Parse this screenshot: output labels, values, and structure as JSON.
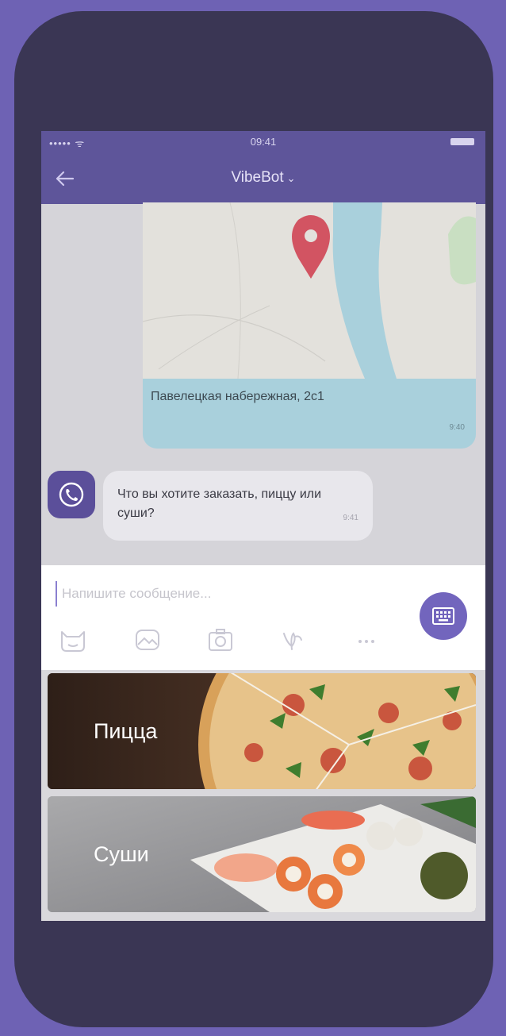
{
  "status_bar": {
    "signal": "••••• ᯤ",
    "time": "09:41"
  },
  "header": {
    "title": "VibeBot",
    "back_icon": "arrow-left-icon",
    "title_icon": "chevron-down-icon"
  },
  "messages": {
    "location": {
      "address": "Павелецкая набережная, 2с1",
      "time": "9:40"
    },
    "bot": {
      "text": "Что вы хотите заказать, пиццу или суши?",
      "time": "9:41"
    }
  },
  "composer": {
    "placeholder": "Напишите сообщение...",
    "tools": [
      "sticker-icon",
      "gallery-icon",
      "camera-icon",
      "doodle-icon",
      "more-icon"
    ],
    "keyboard_button_icon": "keyboard-icon"
  },
  "keyboard_buttons": [
    {
      "label": "Пицца"
    },
    {
      "label": "Суши"
    }
  ],
  "colors": {
    "accent": "#5e559a",
    "button": "#7265bd",
    "location_bubble": "#a9d0dc",
    "background": "#6e62b4"
  }
}
